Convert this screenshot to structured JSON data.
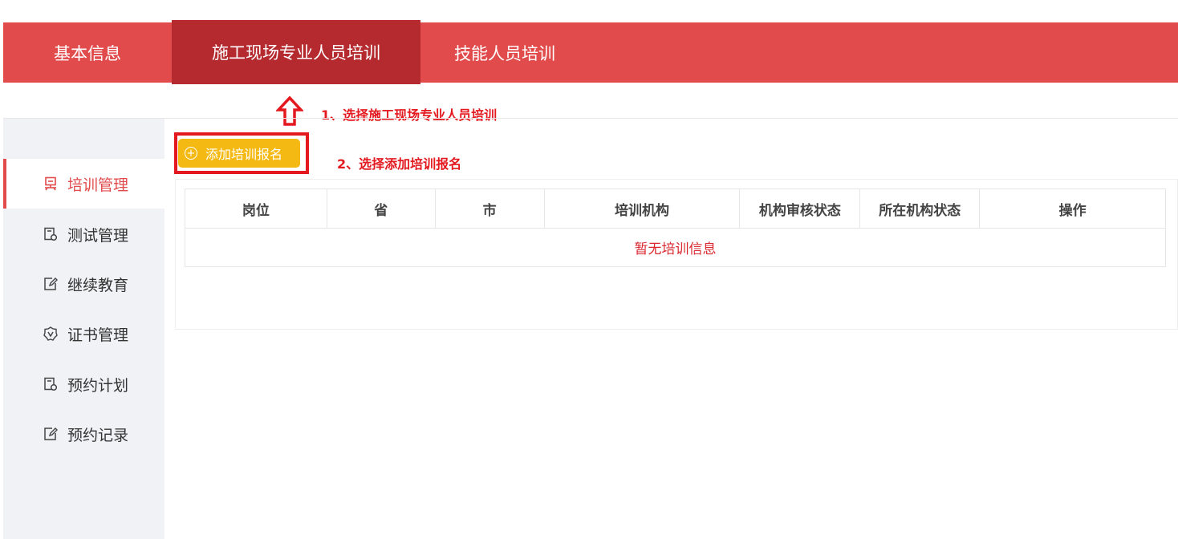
{
  "nav": {
    "tabs": [
      {
        "label": "基本信息"
      },
      {
        "label": "施工现场专业人员培训"
      },
      {
        "label": "技能人员培训"
      }
    ]
  },
  "annotations": {
    "step1": "1、选择施工现场专业人员培训",
    "step2": "2、选择添加培训报名"
  },
  "sidebar": {
    "items": [
      {
        "label": "培训管理",
        "icon": "training-icon"
      },
      {
        "label": "测试管理",
        "icon": "test-icon"
      },
      {
        "label": "继续教育",
        "icon": "edit-icon"
      },
      {
        "label": "证书管理",
        "icon": "certificate-icon"
      },
      {
        "label": "预约计划",
        "icon": "plan-icon"
      },
      {
        "label": "预约记录",
        "icon": "record-icon"
      }
    ]
  },
  "main": {
    "add_button_label": "添加培训报名",
    "table": {
      "columns": [
        "岗位",
        "省",
        "市",
        "培训机构",
        "机构审核状态",
        "所在机构状态",
        "操作"
      ],
      "empty_text": "暂无培训信息"
    }
  },
  "colors": {
    "brand_red": "#e24b4c",
    "active_tab": "#b42a2f",
    "button_yellow": "#f5b914",
    "annotation_red": "#e3191f"
  }
}
